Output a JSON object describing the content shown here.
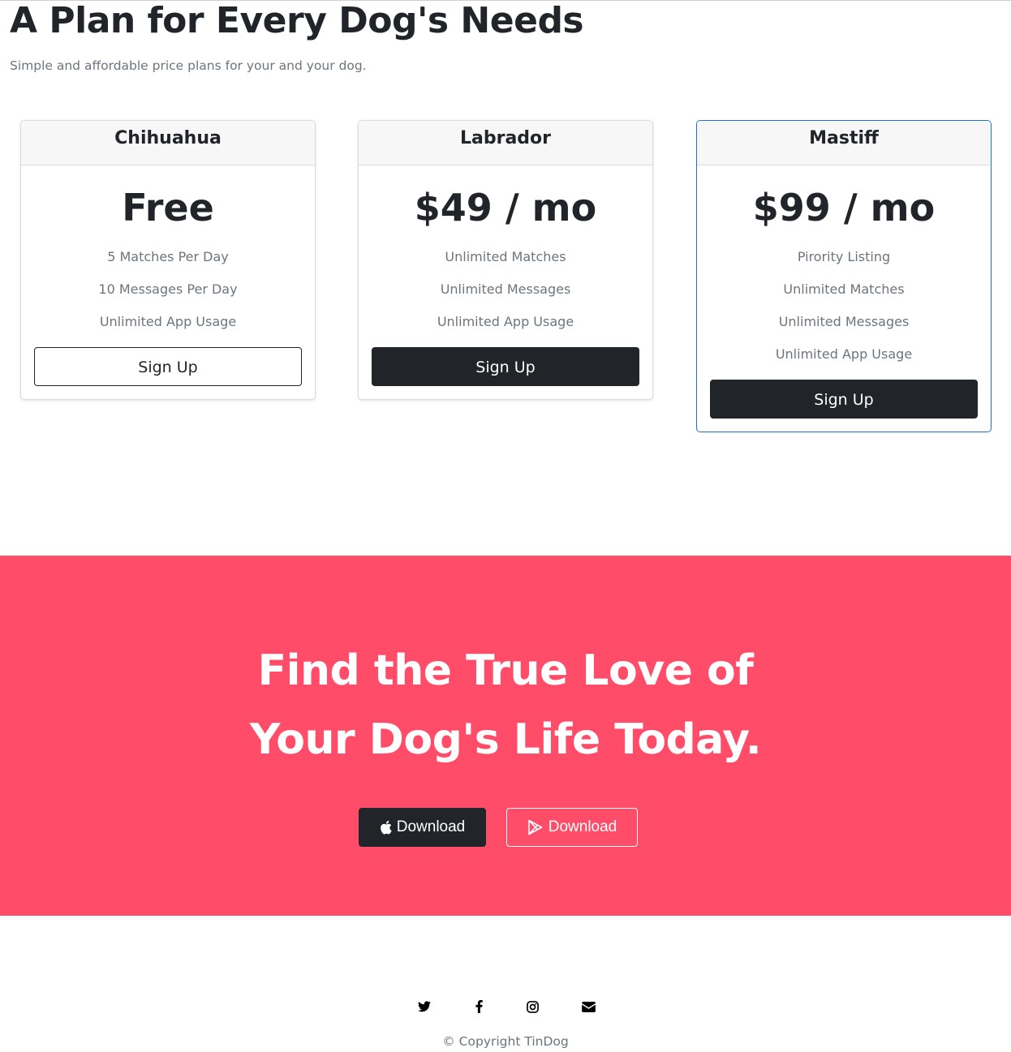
{
  "pricing": {
    "title": "A Plan for Every Dog's Needs",
    "subtitle": "Simple and affordable price plans for your and your dog.",
    "plans": [
      {
        "name": "Chihuahua",
        "price": "Free",
        "features": [
          "5 Matches Per Day",
          "10 Messages Per Day",
          "Unlimited App Usage"
        ],
        "button_label": "Sign Up",
        "button_style": "outline"
      },
      {
        "name": "Labrador",
        "price": "$49 / mo",
        "features": [
          "Unlimited Matches",
          "Unlimited Messages",
          "Unlimited App Usage"
        ],
        "button_label": "Sign Up",
        "button_style": "dark"
      },
      {
        "name": "Mastiff",
        "price": "$99 / mo",
        "features": [
          "Pirority Listing",
          "Unlimited Matches",
          "Unlimited Messages",
          "Unlimited App Usage"
        ],
        "button_label": "Sign Up",
        "button_style": "dark",
        "featured": true
      }
    ]
  },
  "cta": {
    "heading_line1": "Find the True Love of",
    "heading_line2": "Your Dog's Life Today.",
    "apple_button": {
      "label": "Download",
      "icon": "apple-icon"
    },
    "play_button": {
      "label": "Download",
      "icon": "google-play-icon"
    }
  },
  "footer": {
    "social_icons": [
      "twitter-icon",
      "facebook-icon",
      "instagram-icon",
      "envelope-icon"
    ],
    "copyright": "© Copyright TinDog"
  },
  "colors": {
    "accent": "#ff4c68",
    "dark": "#212529",
    "muted": "#6c757d",
    "featured_border": "#1f6fd1"
  }
}
